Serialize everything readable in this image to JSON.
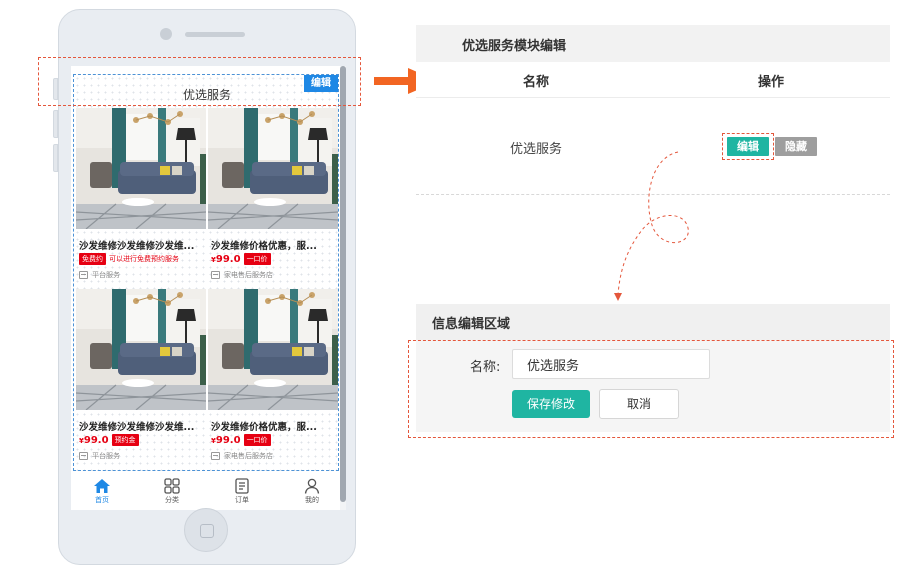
{
  "colors": {
    "accent_blue": "#1e88e5",
    "teal": "#1fb5a2",
    "price_red": "#e60012",
    "hide_gray": "#9e9e9e",
    "guide_orange": "#e4573c"
  },
  "phone": {
    "module_title": "优选服务",
    "edit_badge": "编辑",
    "products": [
      {
        "title": "沙发维修沙发维修沙发维...",
        "tag": "免费约",
        "tag_text": "可以进行免费预约服务",
        "shop": "平台服务"
      },
      {
        "title": "沙发维修价格优惠，服...",
        "price_symbol": "¥",
        "price": "99.0",
        "tag": "一口价",
        "shop": "家电售后服务店"
      },
      {
        "title": "沙发维修沙发维修沙发维...",
        "price_symbol": "¥",
        "price": "99.0",
        "tag": "预约金",
        "shop": "平台服务"
      },
      {
        "title": "沙发维修价格优惠，服...",
        "price_symbol": "¥",
        "price": "99.0",
        "tag": "一口价",
        "shop": "家电售后服务店"
      }
    ],
    "tabs": [
      {
        "label": "首页",
        "icon": "home-icon",
        "active": true
      },
      {
        "label": "分类",
        "icon": "grid-icon",
        "active": false
      },
      {
        "label": "订单",
        "icon": "document-icon",
        "active": false
      },
      {
        "label": "我的",
        "icon": "user-icon",
        "active": false
      }
    ]
  },
  "module_editor": {
    "title": "优选服务模块编辑",
    "columns": {
      "name": "名称",
      "operation": "操作"
    },
    "row": {
      "name": "优选服务",
      "edit_label": "编辑",
      "hide_label": "隐藏"
    }
  },
  "info_editor": {
    "title": "信息编辑区域",
    "name_label": "名称:",
    "name_value": "优选服务",
    "save_label": "保存修改",
    "cancel_label": "取消"
  }
}
